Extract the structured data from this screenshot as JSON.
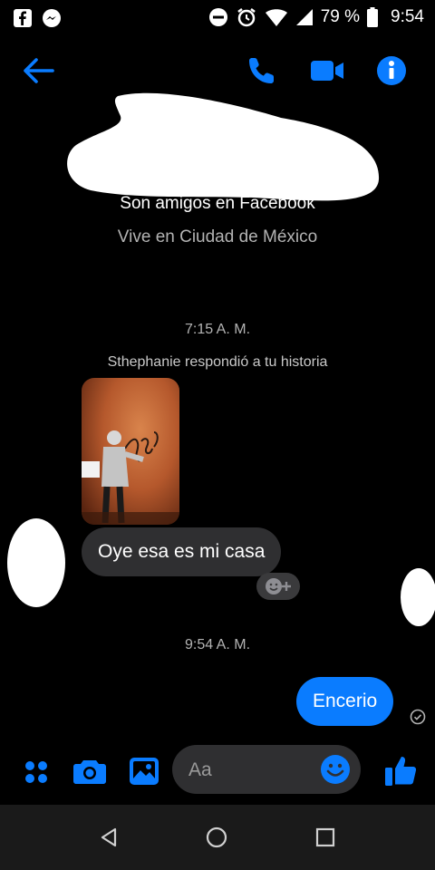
{
  "status_bar": {
    "battery_percent": "79 %",
    "time": "9:54"
  },
  "header": {
    "back_icon": "arrow-left-icon",
    "call_icon": "phone-icon",
    "video_icon": "video-icon",
    "info_icon": "info-icon"
  },
  "profile": {
    "friends_line": "Son amigos en Facebook",
    "location_line": "Vive en Ciudad de México"
  },
  "conversation": {
    "timestamp_1": "7:15 A. M.",
    "story_reply_note": "Sthephanie respondió a tu historia",
    "incoming_message": "Oye esa es mi casa",
    "timestamp_2": "9:54 A. M.",
    "outgoing_message": "Encerio"
  },
  "composer": {
    "placeholder": "Aa"
  },
  "colors": {
    "accent": "#0a7cff",
    "bubble_incoming": "#2f2f31",
    "background": "#000000"
  }
}
